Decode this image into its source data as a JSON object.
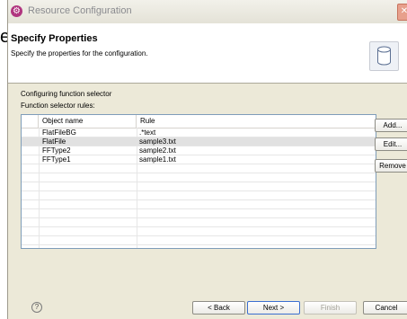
{
  "background": {
    "partial_text": "e"
  },
  "window": {
    "title": "Resource Configuration",
    "close_glyph": "✕",
    "app_icon": "gear-icon"
  },
  "banner": {
    "title": "Specify Properties",
    "description": "Specify the properties for the configuration.",
    "icon": "cylinder-icon"
  },
  "body": {
    "label_configuring": "Configuring function selector",
    "label_rules": "Function selector rules:"
  },
  "table": {
    "columns": [
      "Object name",
      "Rule"
    ],
    "rows": [
      {
        "name": "FlatFileBG",
        "rule": ".*text"
      },
      {
        "name": "FlatFile",
        "rule": "sample3.txt"
      },
      {
        "name": "FFType2",
        "rule": "sample2.txt"
      },
      {
        "name": "FFType1",
        "rule": "sample1.txt"
      }
    ],
    "selected_row": 1
  },
  "side_buttons": {
    "add": "Add...",
    "edit": "Edit...",
    "remove": "Remove"
  },
  "footer": {
    "help": "?",
    "back": "< Back",
    "next": "Next >",
    "finish": "Finish",
    "cancel": "Cancel"
  },
  "colors": {
    "dialog_bg": "#ece9d8",
    "accent_default": "#3c6fd0",
    "title_icon": "#b0357f"
  }
}
